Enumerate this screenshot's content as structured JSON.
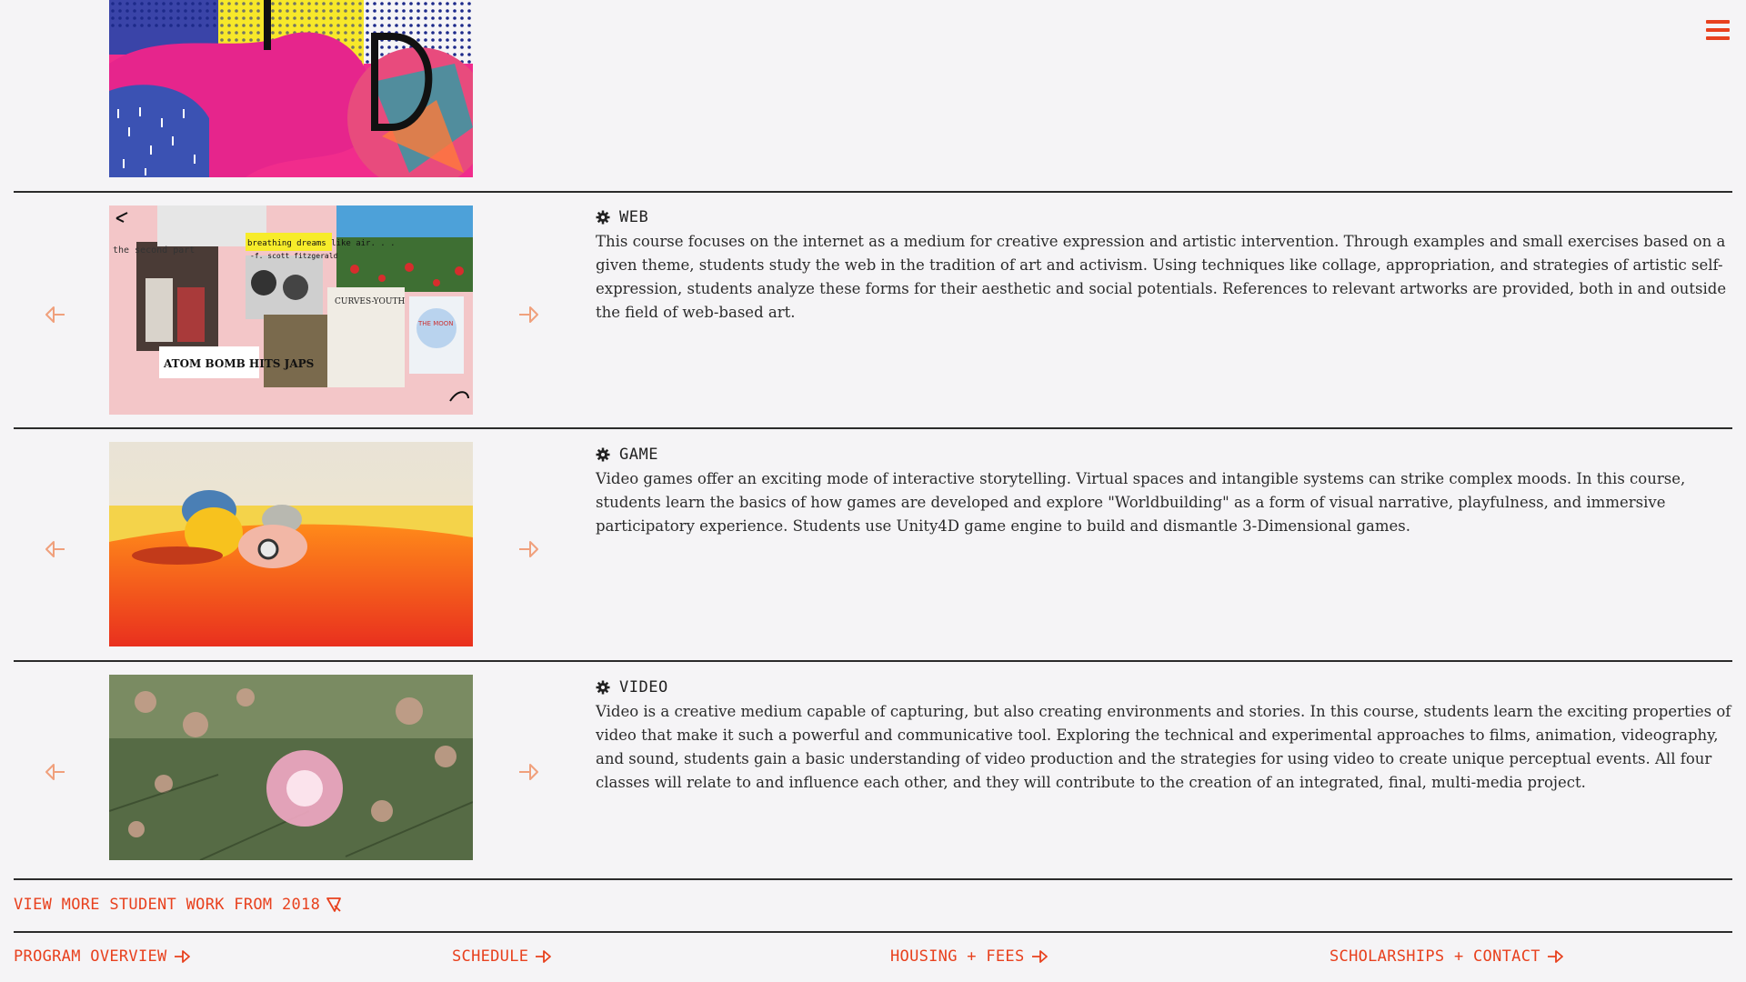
{
  "nav": {
    "menu_icon": "hamburger-icon"
  },
  "courses": [
    {
      "title": "WEB",
      "description": "This course focuses on the internet as a medium for creative expression and artistic intervention. Through examples and small exercises based on a given theme, students study the web in the tradition of art and activism. Using techniques like collage, appropriation, and strategies of artistic self-expression, students analyze these forms for their aesthetic and social potentials. References to relevant artworks are provided, both in and outside the field of web-based art.",
      "image_text": {
        "line1": "breathing dreams like air. . .",
        "line2": "-f. scott fitzgerald",
        "second_part": "the second part",
        "headline": "ATOM BOMB HITS JAPS",
        "youth": "CURVES-YOUTH",
        "moon": "THE MOON"
      }
    },
    {
      "title": "GAME",
      "description": "Video games offer an exciting mode of interactive storytelling. Virtual spaces and intangible systems can strike complex moods. In this course, students learn the basics of how games are developed and explore \"Worldbuilding\" as a form of visual narrative, playfulness, and immersive participatory experience. Students use Unity4D game engine to build and dismantle 3-Dimensional games."
    },
    {
      "title": "VIDEO",
      "description": "Video is a creative medium capable of capturing, but also creating environments and stories. In this course, students learn the exciting properties of video that make it such a powerful and communicative tool.  Exploring the technical and experimental approaches to films, animation, videography, and sound, students gain a basic understanding of video production and the strategies for using video to create unique perceptual events. All four classes will relate to and influence each other, and they will contribute to the creation of an integrated, final, multi-media project."
    }
  ],
  "view_more": "VIEW MORE STUDENT WORK FROM 2018",
  "footer": {
    "links": [
      "PROGRAM OVERVIEW",
      "SCHEDULE",
      "HOUSING + FEES",
      "SCHOLARSHIPS + CONTACT"
    ]
  },
  "colors": {
    "accent": "#e8411e",
    "arrow": "#f0a07c",
    "text": "#2b2b2b",
    "background": "#f5f4f6"
  }
}
